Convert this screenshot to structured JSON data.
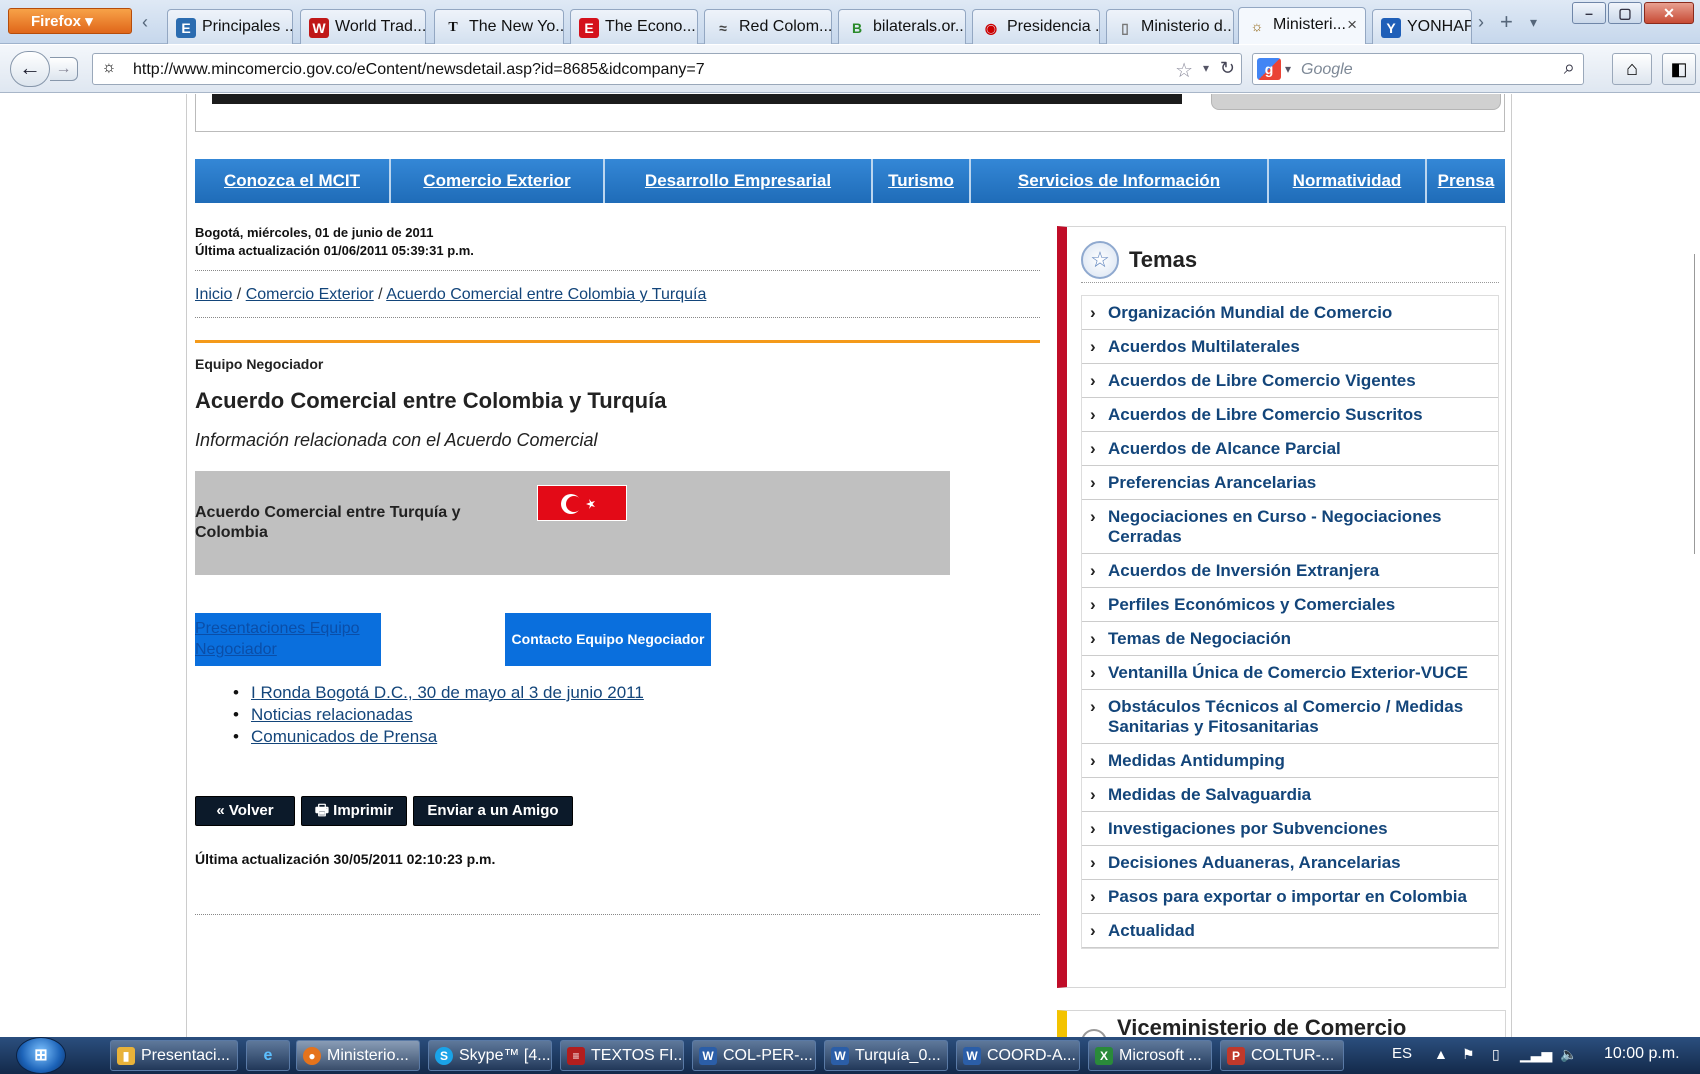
{
  "browser": {
    "menu_label": "Firefox",
    "tabs": [
      {
        "title": "Principales ..."
      },
      {
        "title": "World Trad..."
      },
      {
        "title": "The New Yo..."
      },
      {
        "title": "The Econo..."
      },
      {
        "title": "Red Colom..."
      },
      {
        "title": "bilaterals.or..."
      },
      {
        "title": "Presidencia ..."
      },
      {
        "title": "Ministerio d..."
      },
      {
        "title": "Ministeri..."
      },
      {
        "title": "YONHAP"
      }
    ],
    "url": "http://www.mincomercio.gov.co/eContent/newsdetail.asp?id=8685&idcompany=7",
    "search_placeholder": "Google"
  },
  "page": {
    "nav": [
      "Conozca el MCIT",
      "Comercio Exterior",
      "Desarrollo Empresarial",
      "Turismo",
      "Servicios de Información",
      "Normatividad",
      "Prensa"
    ],
    "date_line": "Bogotá, miércoles, 01 de junio de 2011",
    "update_line": "Última actualización 01/06/2011 05:39:31 p.m.",
    "breadcrumb": {
      "home": "Inicio",
      "sep": " / ",
      "section": "Comercio Exterior",
      "current": "Acuerdo Comercial entre Colombia y Turquía"
    },
    "section_label": "Equipo Negociador",
    "title": "Acuerdo Comercial entre Colombia y Turquía",
    "subtitle": "Información relacionada con el Acuerdo Comercial",
    "gray_box_text": "Acuerdo Comercial  entre Turquía y Colombia",
    "btn_presentaciones": "Presentaciones Equipo Negociador",
    "btn_contacto": "Contacto Equipo Negociador",
    "links": [
      "I Ronda Bogotá D.C., 30 de mayo al 3 de junio 2011",
      "Noticias relacionadas",
      "Comunicados de Prensa"
    ],
    "actions": {
      "back": "« Volver",
      "print": "Imprimir",
      "send": "Enviar a un Amigo"
    },
    "last_update": "Última actualización 30/05/2011 02:10:23 p.m."
  },
  "sidebar": {
    "title": "Temas",
    "items": [
      "Organización Mundial de Comercio",
      "Acuerdos Multilaterales",
      "Acuerdos de Libre Comercio Vigentes",
      "Acuerdos de Libre Comercio Suscritos",
      "Acuerdos de Alcance Parcial",
      "Preferencias Arancelarias",
      "Negociaciones en Curso - Negociaciones Cerradas",
      "Acuerdos de Inversión Extranjera",
      "Perfiles Económicos y Comerciales",
      "Temas de Negociación",
      "Ventanilla Única de Comercio Exterior-VUCE",
      "Obstáculos Técnicos al Comercio / Medidas Sanitarias y Fitosanitarias",
      "Medidas Antidumping",
      "Medidas de Salvaguardia",
      "Investigaciones por Subvenciones",
      "Decisiones Aduaneras, Arancelarias",
      "Pasos para exportar o importar en Colombia",
      "Actualidad"
    ],
    "next_box_title": "Viceministerio de Comercio"
  },
  "taskbar": {
    "items": [
      "Presentaci...",
      "",
      "Ministerio...",
      "Skype™ [4...",
      "TEXTOS FI...",
      "COL-PER-...",
      "Turquía_0...",
      "COORD-A...",
      "Microsoft ...",
      "COLTUR-..."
    ],
    "lang": "ES",
    "clock": "10:00 p.m."
  },
  "colors": {
    "nav_blue": "#1f6cb8",
    "accent_orange": "#f49a1a",
    "sidebar_red": "#c00d28",
    "link_blue": "#13457a",
    "button_blue": "#0a6fdd"
  }
}
